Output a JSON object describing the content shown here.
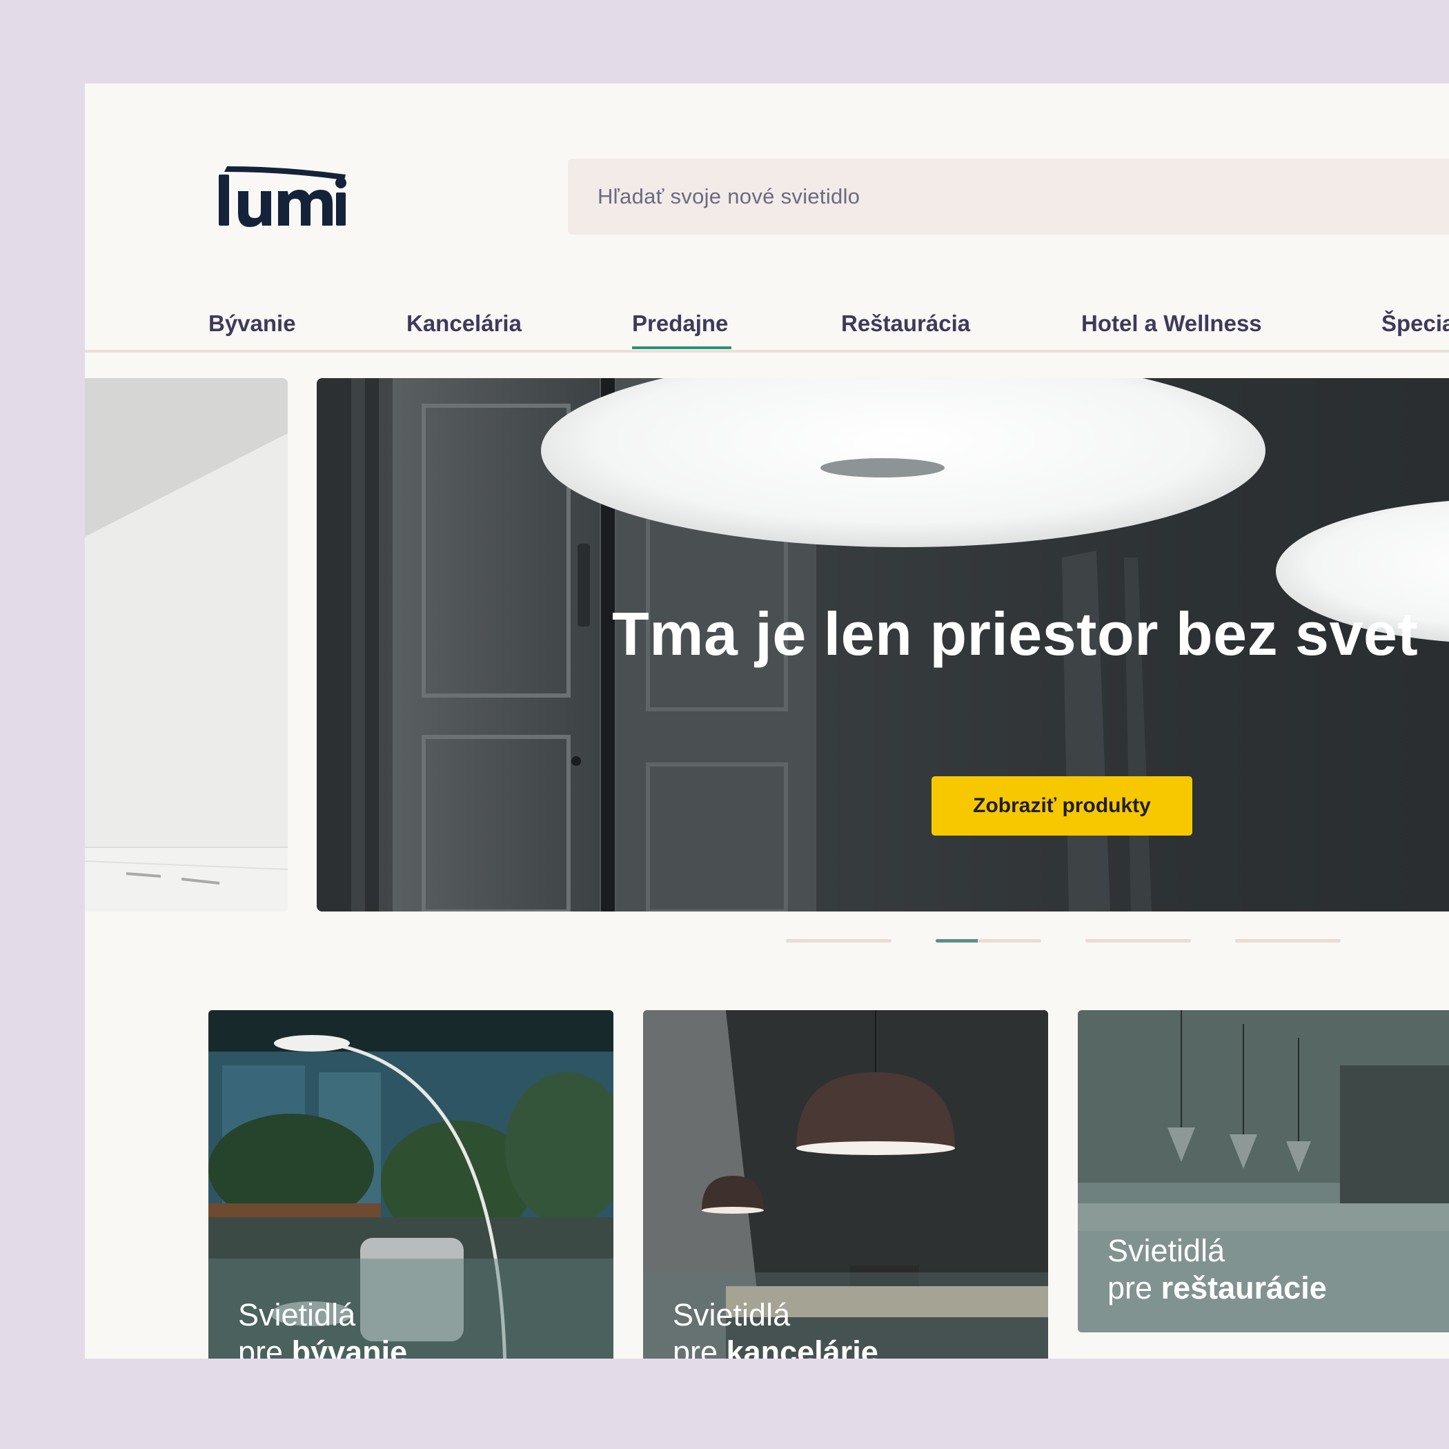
{
  "brand": {
    "logo_text": "lumi"
  },
  "search": {
    "placeholder": "Hľadať svoje nové svietidlo"
  },
  "nav": {
    "items": [
      {
        "label": "Bývanie"
      },
      {
        "label": "Kancelária"
      },
      {
        "label": "Predajne",
        "active": true
      },
      {
        "label": "Reštaurácia"
      },
      {
        "label": "Hotel a Wellness"
      },
      {
        "label": "Špecia"
      }
    ]
  },
  "hero": {
    "title": "Tma je len priestor bez svet",
    "cta_label": "Zobraziť produkty"
  },
  "carousel": {
    "slide_count": 4,
    "active_index": 1,
    "active_progress": 0.4
  },
  "categories": [
    {
      "prefix": "Svietidlá",
      "pre": "pre",
      "emphasis": "bývanie"
    },
    {
      "prefix": "Svietidlá",
      "pre": "pre",
      "emphasis": "kancelárie"
    },
    {
      "prefix": "Svietidlá",
      "pre": "pre",
      "emphasis": "reštaurácie"
    }
  ],
  "colors": {
    "page_bg": "#e3dce8",
    "surface": "#faf8f5",
    "nav_text": "#3d3a5c",
    "nav_active": "#2e8f75",
    "cta": "#f7c800",
    "logo": "#14233a"
  }
}
